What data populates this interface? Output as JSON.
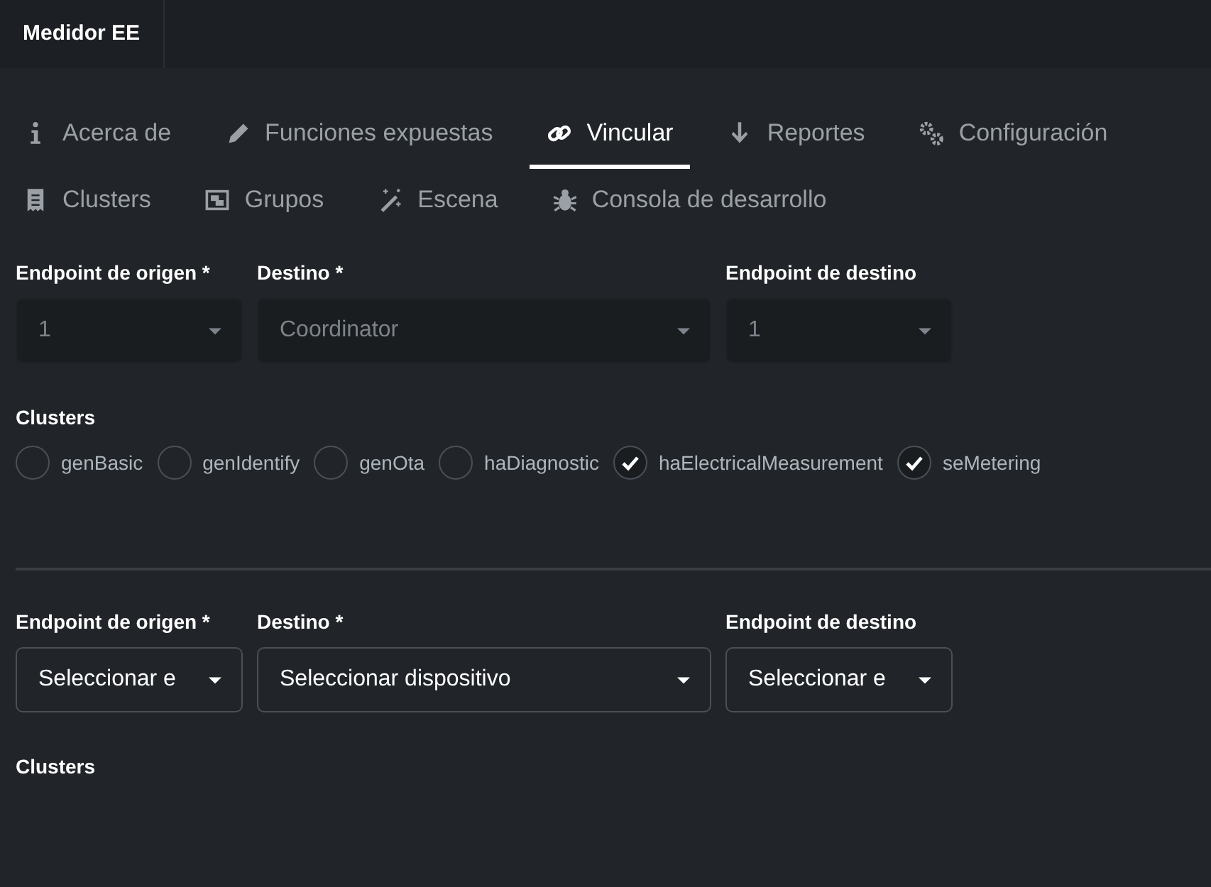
{
  "header": {
    "title": "Medidor EE"
  },
  "tabs": [
    {
      "label": "Acerca de",
      "selected": false
    },
    {
      "label": "Funciones expuestas",
      "selected": false
    },
    {
      "label": "Vincular",
      "selected": true
    },
    {
      "label": "Reportes",
      "selected": false
    },
    {
      "label": "Configuración",
      "selected": false
    },
    {
      "label": "Clusters",
      "selected": false
    },
    {
      "label": "Grupos",
      "selected": false
    },
    {
      "label": "Escena",
      "selected": false
    },
    {
      "label": "Consola de desarrollo",
      "selected": false
    }
  ],
  "bindings": [
    {
      "fields": [
        {
          "label": "Endpoint de origen *",
          "value": "1",
          "disabled": true
        },
        {
          "label": "Destino *",
          "value": "Coordinator",
          "disabled": true
        },
        {
          "label": "Endpoint de destino",
          "value": "1",
          "disabled": true
        }
      ],
      "clusters_label": "Clusters",
      "clusters": [
        {
          "name": "genBasic",
          "checked": false
        },
        {
          "name": "genIdentify",
          "checked": false
        },
        {
          "name": "genOta",
          "checked": false
        },
        {
          "name": "haDiagnostic",
          "checked": false
        },
        {
          "name": "haElectricalMeasurement",
          "checked": true
        },
        {
          "name": "seMetering",
          "checked": true
        }
      ]
    },
    {
      "fields": [
        {
          "label": "Endpoint de origen *",
          "value": "Seleccionar e",
          "disabled": false
        },
        {
          "label": "Destino *",
          "value": "Seleccionar dispositivo",
          "disabled": false
        },
        {
          "label": "Endpoint de destino",
          "value": "Seleccionar e",
          "disabled": false
        }
      ],
      "clusters_label": "Clusters"
    }
  ]
}
